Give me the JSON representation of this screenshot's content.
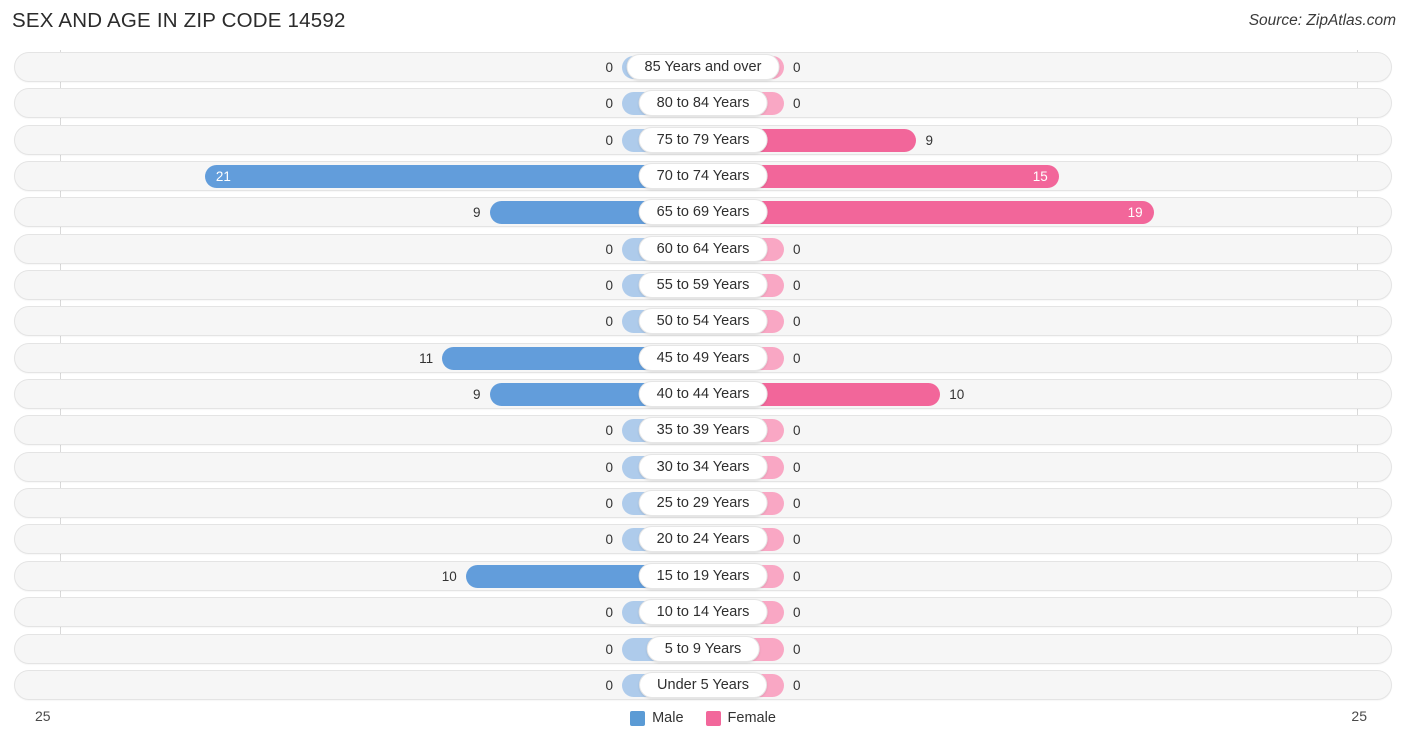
{
  "header": {
    "title": "SEX AND AGE IN ZIP CODE 14592",
    "source": "Source: ZipAtlas.com"
  },
  "axis": {
    "left_label": "25",
    "right_label": "25",
    "max": 25
  },
  "legend": {
    "items": [
      {
        "label": "Male",
        "color": "#5b9bd5"
      },
      {
        "label": "Female",
        "color": "#f2679b"
      }
    ]
  },
  "colors": {
    "male_strong": "#629ddb",
    "male_light": "#aecbeb",
    "female_strong": "#f2669a",
    "female_light": "#f9a7c4",
    "track": "#f6f6f6"
  },
  "chart_data": {
    "type": "bar",
    "title": "SEX AND AGE IN ZIP CODE 14592",
    "subtitle": "Source: ZipAtlas.com",
    "orientation": "horizontal-diverging",
    "xlabel": "",
    "ylabel": "",
    "xlim": [
      -25,
      25
    ],
    "axis_ticks": [
      "25",
      "25"
    ],
    "grid": false,
    "legend_position": "bottom-center",
    "categories": [
      "85 Years and over",
      "80 to 84 Years",
      "75 to 79 Years",
      "70 to 74 Years",
      "65 to 69 Years",
      "60 to 64 Years",
      "55 to 59 Years",
      "50 to 54 Years",
      "45 to 49 Years",
      "40 to 44 Years",
      "35 to 39 Years",
      "30 to 34 Years",
      "25 to 29 Years",
      "20 to 24 Years",
      "15 to 19 Years",
      "10 to 14 Years",
      "5 to 9 Years",
      "Under 5 Years"
    ],
    "series": [
      {
        "name": "Male",
        "values": [
          0,
          0,
          0,
          21,
          9,
          0,
          0,
          0,
          11,
          9,
          0,
          0,
          0,
          0,
          10,
          0,
          0,
          0
        ]
      },
      {
        "name": "Female",
        "values": [
          0,
          0,
          9,
          15,
          19,
          0,
          0,
          0,
          0,
          10,
          0,
          0,
          0,
          0,
          0,
          0,
          0,
          0
        ]
      }
    ]
  }
}
